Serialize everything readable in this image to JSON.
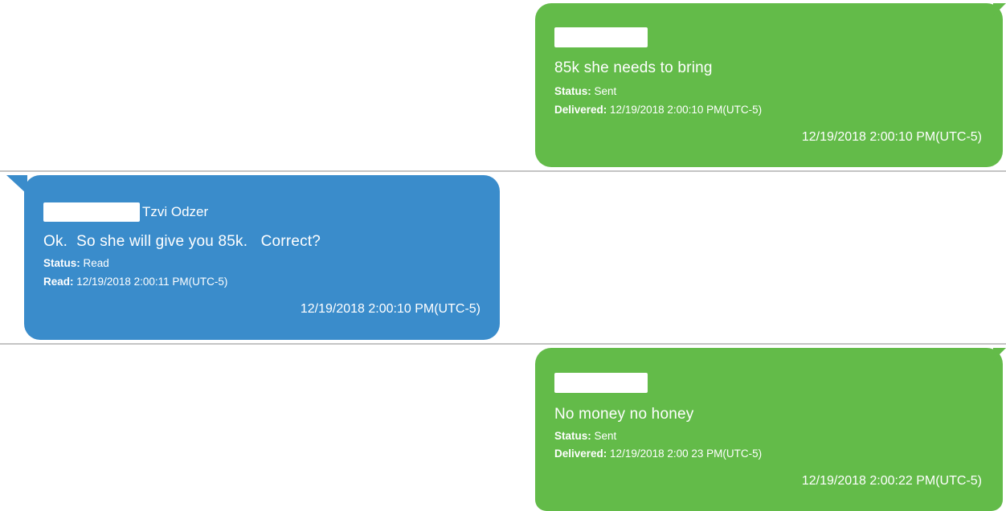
{
  "conversation": {
    "messages": [
      {
        "direction": "outgoing",
        "sender_name": "",
        "body": "85k she needs to bring",
        "status_label": "Status:",
        "status_value": "Sent",
        "event_label": "Delivered:",
        "event_value": "12/19/2018 2:00:10 PM(UTC-5)",
        "timestamp": "12/19/2018 2:00:10 PM(UTC-5)"
      },
      {
        "direction": "incoming",
        "sender_name": "Tzvi Odzer",
        "body": "Ok.  So she will give you 85k.   Correct?",
        "status_label": "Status:",
        "status_value": "Read",
        "event_label": "Read:",
        "event_value": "12/19/2018 2:00:11 PM(UTC-5)",
        "timestamp": "12/19/2018 2:00:10 PM(UTC-5)"
      },
      {
        "direction": "outgoing",
        "sender_name": "",
        "body": "No money no honey",
        "status_label": "Status:",
        "status_value": "Sent",
        "event_label": "Delivered:",
        "event_value": "12/19/2018 2:00 23 PM(UTC-5)",
        "timestamp": "12/19/2018 2:00:22 PM(UTC-5)"
      }
    ]
  },
  "colors": {
    "outgoing_bubble": "#63bb49",
    "incoming_bubble": "#3a8ccb",
    "divider": "#c4c4c4",
    "text": "#ffffff"
  }
}
